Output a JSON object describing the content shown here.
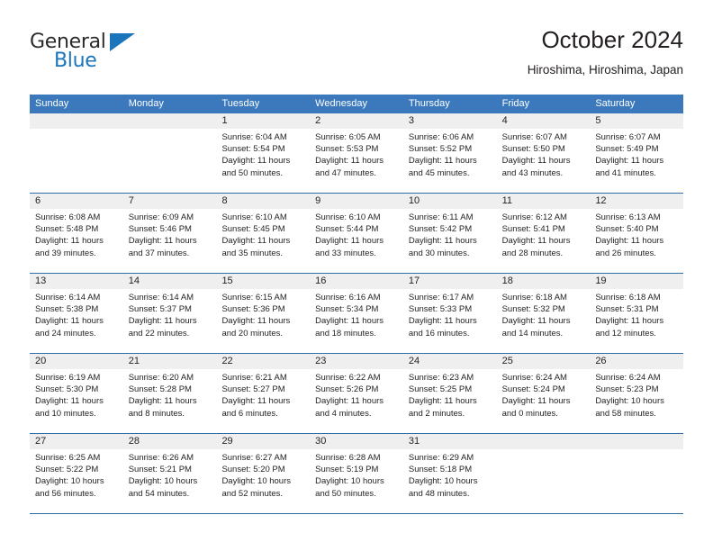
{
  "brand": {
    "name_part1": "General",
    "name_part2": "Blue",
    "triangle_color": "#1b75bb"
  },
  "header": {
    "title": "October 2024",
    "subtitle": "Hiroshima, Hiroshima, Japan"
  },
  "theme": {
    "header_blue": "#3b79bc",
    "separator_blue": "#2e6da8",
    "date_band_gray": "#efefef",
    "text": "#231f20"
  },
  "weekdays": [
    "Sunday",
    "Monday",
    "Tuesday",
    "Wednesday",
    "Thursday",
    "Friday",
    "Saturday"
  ],
  "weeks": [
    {
      "days": [
        {
          "date": "",
          "lines": [
            "",
            "",
            "",
            ""
          ]
        },
        {
          "date": "",
          "lines": [
            "",
            "",
            "",
            ""
          ]
        },
        {
          "date": "1",
          "lines": [
            "Sunrise: 6:04 AM",
            "Sunset: 5:54 PM",
            "Daylight: 11 hours",
            "and 50 minutes."
          ]
        },
        {
          "date": "2",
          "lines": [
            "Sunrise: 6:05 AM",
            "Sunset: 5:53 PM",
            "Daylight: 11 hours",
            "and 47 minutes."
          ]
        },
        {
          "date": "3",
          "lines": [
            "Sunrise: 6:06 AM",
            "Sunset: 5:52 PM",
            "Daylight: 11 hours",
            "and 45 minutes."
          ]
        },
        {
          "date": "4",
          "lines": [
            "Sunrise: 6:07 AM",
            "Sunset: 5:50 PM",
            "Daylight: 11 hours",
            "and 43 minutes."
          ]
        },
        {
          "date": "5",
          "lines": [
            "Sunrise: 6:07 AM",
            "Sunset: 5:49 PM",
            "Daylight: 11 hours",
            "and 41 minutes."
          ]
        }
      ]
    },
    {
      "days": [
        {
          "date": "6",
          "lines": [
            "Sunrise: 6:08 AM",
            "Sunset: 5:48 PM",
            "Daylight: 11 hours",
            "and 39 minutes."
          ]
        },
        {
          "date": "7",
          "lines": [
            "Sunrise: 6:09 AM",
            "Sunset: 5:46 PM",
            "Daylight: 11 hours",
            "and 37 minutes."
          ]
        },
        {
          "date": "8",
          "lines": [
            "Sunrise: 6:10 AM",
            "Sunset: 5:45 PM",
            "Daylight: 11 hours",
            "and 35 minutes."
          ]
        },
        {
          "date": "9",
          "lines": [
            "Sunrise: 6:10 AM",
            "Sunset: 5:44 PM",
            "Daylight: 11 hours",
            "and 33 minutes."
          ]
        },
        {
          "date": "10",
          "lines": [
            "Sunrise: 6:11 AM",
            "Sunset: 5:42 PM",
            "Daylight: 11 hours",
            "and 30 minutes."
          ]
        },
        {
          "date": "11",
          "lines": [
            "Sunrise: 6:12 AM",
            "Sunset: 5:41 PM",
            "Daylight: 11 hours",
            "and 28 minutes."
          ]
        },
        {
          "date": "12",
          "lines": [
            "Sunrise: 6:13 AM",
            "Sunset: 5:40 PM",
            "Daylight: 11 hours",
            "and 26 minutes."
          ]
        }
      ]
    },
    {
      "days": [
        {
          "date": "13",
          "lines": [
            "Sunrise: 6:14 AM",
            "Sunset: 5:38 PM",
            "Daylight: 11 hours",
            "and 24 minutes."
          ]
        },
        {
          "date": "14",
          "lines": [
            "Sunrise: 6:14 AM",
            "Sunset: 5:37 PM",
            "Daylight: 11 hours",
            "and 22 minutes."
          ]
        },
        {
          "date": "15",
          "lines": [
            "Sunrise: 6:15 AM",
            "Sunset: 5:36 PM",
            "Daylight: 11 hours",
            "and 20 minutes."
          ]
        },
        {
          "date": "16",
          "lines": [
            "Sunrise: 6:16 AM",
            "Sunset: 5:34 PM",
            "Daylight: 11 hours",
            "and 18 minutes."
          ]
        },
        {
          "date": "17",
          "lines": [
            "Sunrise: 6:17 AM",
            "Sunset: 5:33 PM",
            "Daylight: 11 hours",
            "and 16 minutes."
          ]
        },
        {
          "date": "18",
          "lines": [
            "Sunrise: 6:18 AM",
            "Sunset: 5:32 PM",
            "Daylight: 11 hours",
            "and 14 minutes."
          ]
        },
        {
          "date": "19",
          "lines": [
            "Sunrise: 6:18 AM",
            "Sunset: 5:31 PM",
            "Daylight: 11 hours",
            "and 12 minutes."
          ]
        }
      ]
    },
    {
      "days": [
        {
          "date": "20",
          "lines": [
            "Sunrise: 6:19 AM",
            "Sunset: 5:30 PM",
            "Daylight: 11 hours",
            "and 10 minutes."
          ]
        },
        {
          "date": "21",
          "lines": [
            "Sunrise: 6:20 AM",
            "Sunset: 5:28 PM",
            "Daylight: 11 hours",
            "and 8 minutes."
          ]
        },
        {
          "date": "22",
          "lines": [
            "Sunrise: 6:21 AM",
            "Sunset: 5:27 PM",
            "Daylight: 11 hours",
            "and 6 minutes."
          ]
        },
        {
          "date": "23",
          "lines": [
            "Sunrise: 6:22 AM",
            "Sunset: 5:26 PM",
            "Daylight: 11 hours",
            "and 4 minutes."
          ]
        },
        {
          "date": "24",
          "lines": [
            "Sunrise: 6:23 AM",
            "Sunset: 5:25 PM",
            "Daylight: 11 hours",
            "and 2 minutes."
          ]
        },
        {
          "date": "25",
          "lines": [
            "Sunrise: 6:24 AM",
            "Sunset: 5:24 PM",
            "Daylight: 11 hours",
            "and 0 minutes."
          ]
        },
        {
          "date": "26",
          "lines": [
            "Sunrise: 6:24 AM",
            "Sunset: 5:23 PM",
            "Daylight: 10 hours",
            "and 58 minutes."
          ]
        }
      ]
    },
    {
      "days": [
        {
          "date": "27",
          "lines": [
            "Sunrise: 6:25 AM",
            "Sunset: 5:22 PM",
            "Daylight: 10 hours",
            "and 56 minutes."
          ]
        },
        {
          "date": "28",
          "lines": [
            "Sunrise: 6:26 AM",
            "Sunset: 5:21 PM",
            "Daylight: 10 hours",
            "and 54 minutes."
          ]
        },
        {
          "date": "29",
          "lines": [
            "Sunrise: 6:27 AM",
            "Sunset: 5:20 PM",
            "Daylight: 10 hours",
            "and 52 minutes."
          ]
        },
        {
          "date": "30",
          "lines": [
            "Sunrise: 6:28 AM",
            "Sunset: 5:19 PM",
            "Daylight: 10 hours",
            "and 50 minutes."
          ]
        },
        {
          "date": "31",
          "lines": [
            "Sunrise: 6:29 AM",
            "Sunset: 5:18 PM",
            "Daylight: 10 hours",
            "and 48 minutes."
          ]
        },
        {
          "date": "",
          "lines": [
            "",
            "",
            "",
            ""
          ]
        },
        {
          "date": "",
          "lines": [
            "",
            "",
            "",
            ""
          ]
        }
      ]
    }
  ]
}
